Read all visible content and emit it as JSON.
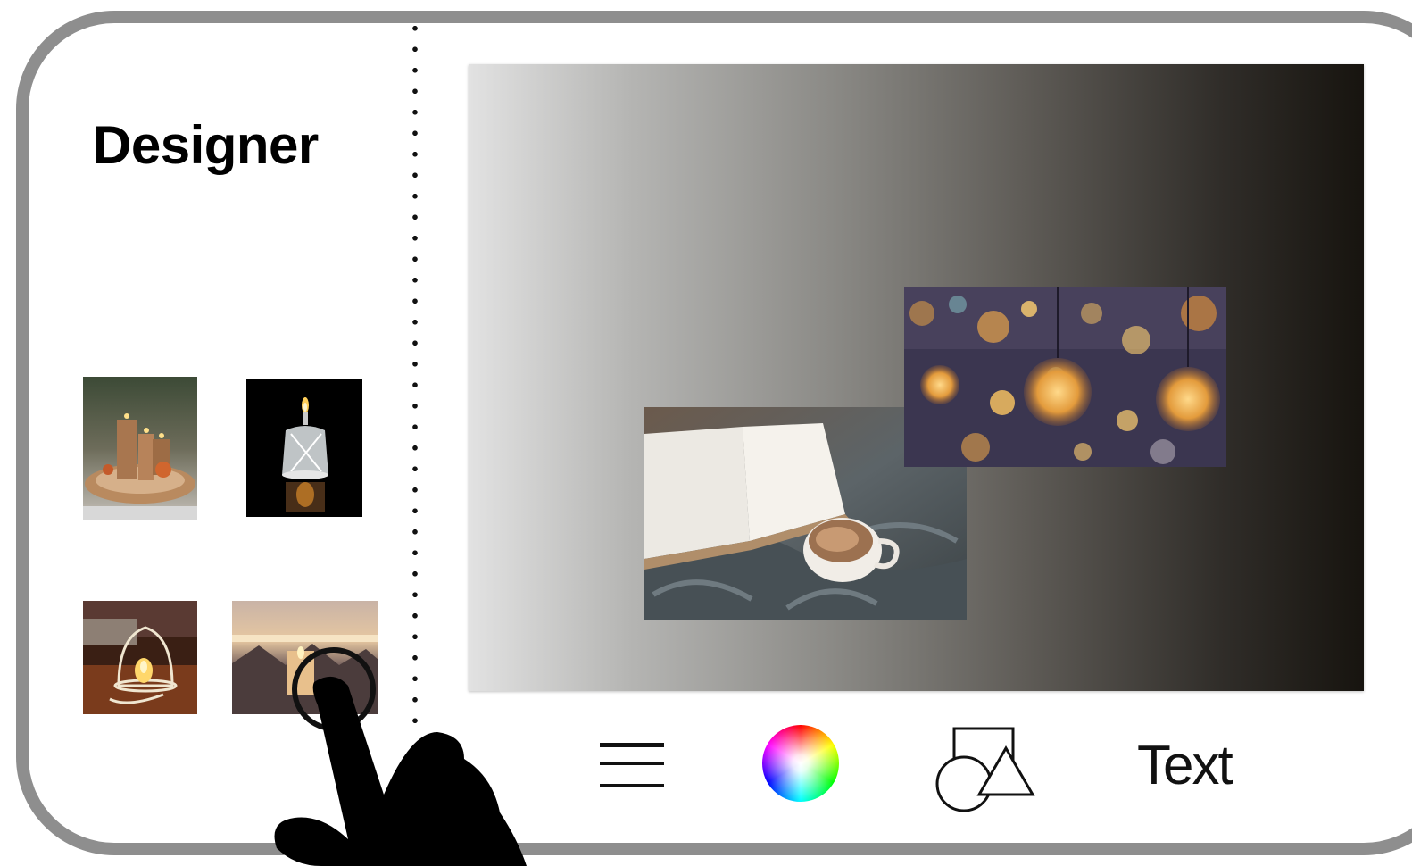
{
  "sidebar": {
    "title": "Designer",
    "thumbnails": [
      {
        "name": "candles-tray"
      },
      {
        "name": "candle-jar"
      },
      {
        "name": "candle-birdcage"
      },
      {
        "name": "candle-sunset"
      }
    ]
  },
  "canvas": {
    "background": {
      "type": "linear-gradient",
      "from": "#e2e2e2",
      "to": "#17140f"
    },
    "placed_images": [
      {
        "name": "book-and-coffee"
      },
      {
        "name": "string-lights-bokeh"
      }
    ]
  },
  "toolbar": {
    "items": [
      {
        "name": "menu",
        "icon": "hamburger-menu-icon"
      },
      {
        "name": "color",
        "icon": "color-wheel-icon"
      },
      {
        "name": "shapes",
        "icon": "shapes-icon"
      },
      {
        "name": "text",
        "label": "Text"
      }
    ]
  },
  "gesture": {
    "icon": "pointing-hand-icon"
  }
}
